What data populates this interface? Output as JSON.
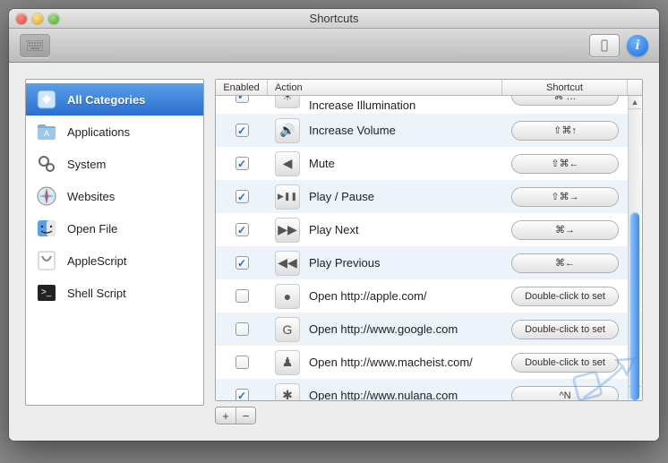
{
  "window": {
    "title": "Shortcuts"
  },
  "toolbar": {
    "left_button": "keyboard-view",
    "right_button": "device-toggle",
    "info_button": "info"
  },
  "sidebar": {
    "items": [
      {
        "label": "All Categories",
        "icon": "categories-icon",
        "selected": true
      },
      {
        "label": "Applications",
        "icon": "folder-apps-icon",
        "selected": false
      },
      {
        "label": "System",
        "icon": "gears-icon",
        "selected": false
      },
      {
        "label": "Websites",
        "icon": "safari-icon",
        "selected": false
      },
      {
        "label": "Open File",
        "icon": "finder-icon",
        "selected": false
      },
      {
        "label": "AppleScript",
        "icon": "applescript-icon",
        "selected": false
      },
      {
        "label": "Shell Script",
        "icon": "terminal-icon",
        "selected": false
      }
    ]
  },
  "table": {
    "headers": {
      "enabled": "Enabled",
      "action": "Action",
      "shortcut": "Shortcut"
    },
    "rows": [
      {
        "enabled": true,
        "icon": "brightness-up-icon",
        "label": "Increase Illumination",
        "shortcut": "⌘ …",
        "cut": true
      },
      {
        "enabled": true,
        "icon": "volume-up-icon",
        "label": "Increase Volume",
        "shortcut": "⇧⌘↑"
      },
      {
        "enabled": true,
        "icon": "mute-icon",
        "label": "Mute",
        "shortcut": "⇧⌘←"
      },
      {
        "enabled": true,
        "icon": "play-pause-icon",
        "label": "Play / Pause",
        "shortcut": "⇧⌘→"
      },
      {
        "enabled": true,
        "icon": "play-next-icon",
        "label": "Play Next",
        "shortcut": "⌘→"
      },
      {
        "enabled": true,
        "icon": "play-previous-icon",
        "label": "Play Previous",
        "shortcut": "⌘←"
      },
      {
        "enabled": false,
        "icon": "apple-icon",
        "label": "Open http://apple.com/",
        "shortcut": "Double-click to set"
      },
      {
        "enabled": false,
        "icon": "google-icon",
        "label": "Open http://www.google.com",
        "shortcut": "Double-click to set"
      },
      {
        "enabled": false,
        "icon": "macheist-icon",
        "label": "Open http://www.macheist.com/",
        "shortcut": "Double-click to set"
      },
      {
        "enabled": true,
        "icon": "nulana-icon",
        "label": "Open http://www.nulana.com",
        "shortcut": "^N"
      }
    ]
  },
  "buttons": {
    "add": "+",
    "remove": "−"
  },
  "colors": {
    "selection_top": "#5a9ee8",
    "selection_bottom": "#2c6fcf",
    "scroll_thumb": "#3d8de8"
  }
}
